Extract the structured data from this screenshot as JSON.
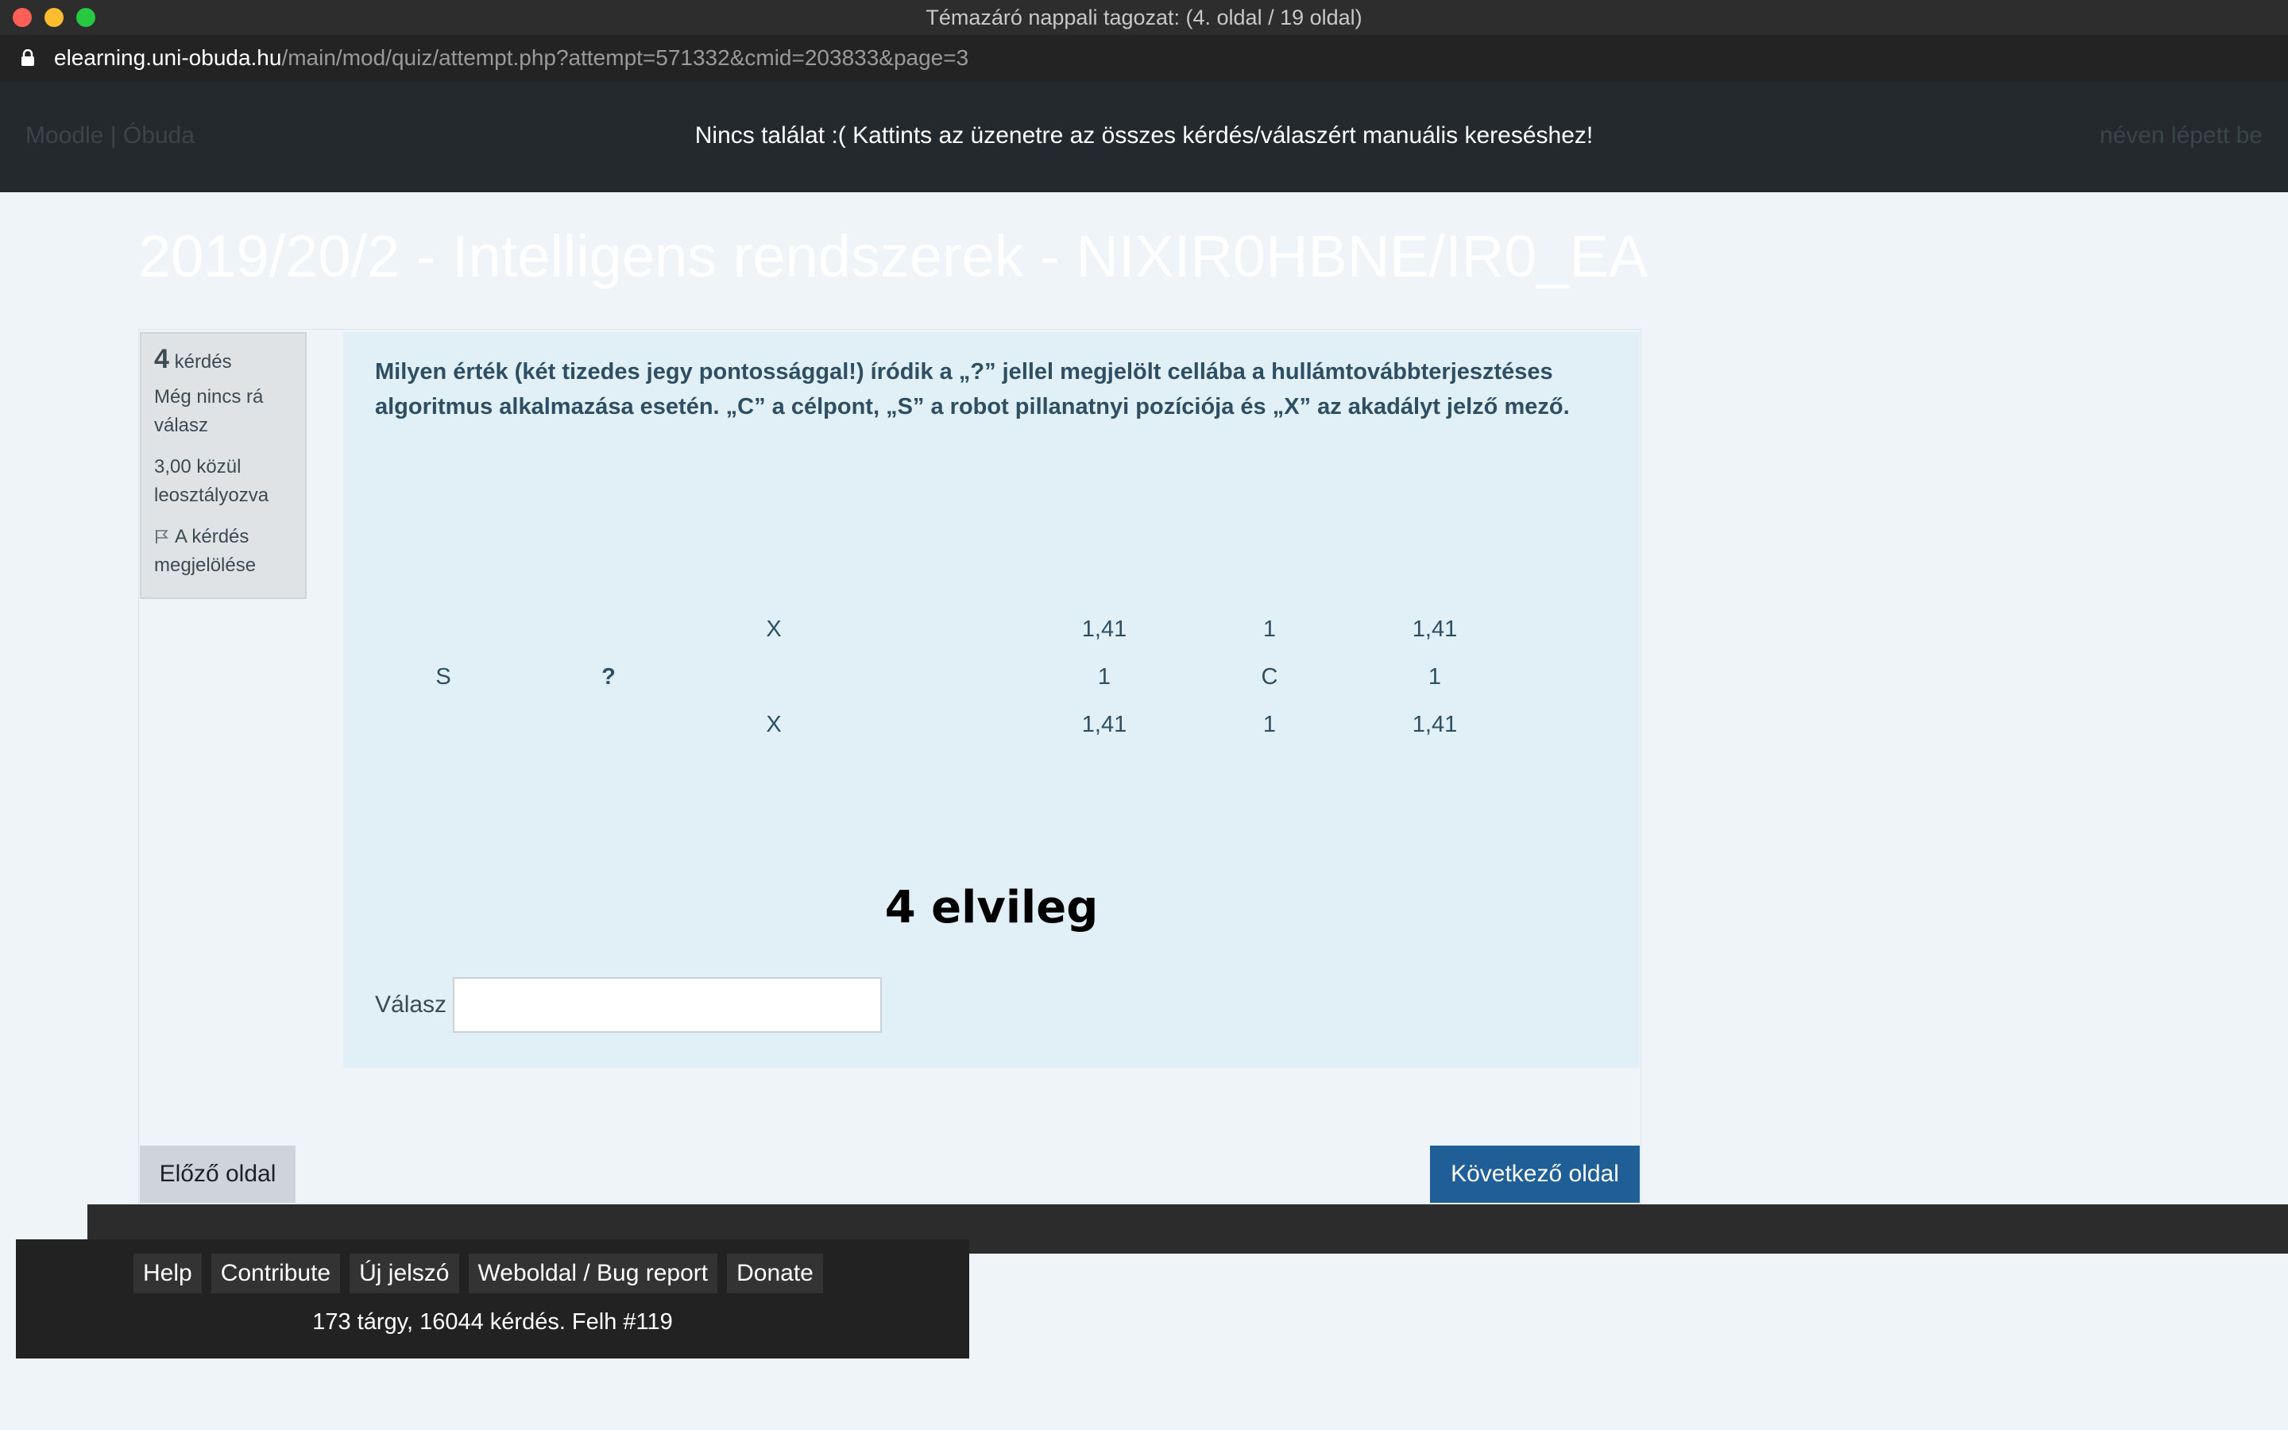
{
  "window": {
    "title": "Témazáró nappali tagozat: (4. oldal / 19 oldal)"
  },
  "urlbar": {
    "host": "elearning.uni-obuda.hu",
    "path": "/main/mod/quiz/attempt.php?attempt=571332&cmid=203833&page=3"
  },
  "header": {
    "brand": "Moodle | Óbuda",
    "notice": "Nincs találat :( Kattints az üzenetre az összes kérdés/válaszért manuális kereséshez!",
    "login": "néven lépett be"
  },
  "course": {
    "title": "2019/20/2 - Intelligens rendszerek - NIXIR0HBNE/IR0_EA"
  },
  "info": {
    "number": "4",
    "number_label": "kérdés",
    "state": "Még nincs rá válasz",
    "grade": "3,00 közül leosztályozva",
    "flag": "A kérdés megjelölése"
  },
  "question": {
    "text": "Milyen érték (két tizedes jegy pontossággal!) íródik a „?” jellel megjelölt cellába a hullámtovábbterjesztéses algoritmus alkalmazása esetén. „C” a célpont, „S” a robot pillanatnyi pozíciója és „X” az akadályt jelző mező.",
    "grid": [
      [
        "",
        "",
        "X",
        "",
        "1,41",
        "1",
        "1,41"
      ],
      [
        "S",
        "?",
        "",
        "",
        "1",
        "C",
        "1"
      ],
      [
        "",
        "",
        "X",
        "",
        "1,41",
        "1",
        "1,41"
      ]
    ],
    "annotation": "4 elvileg",
    "answer_label": "Válasz",
    "answer_value": ""
  },
  "nav": {
    "prev": "Előző oldal",
    "next": "Következő oldal"
  },
  "overlay": {
    "links": [
      "Help",
      "Contribute",
      "Új jelszó",
      "Weboldal / Bug report",
      "Donate"
    ],
    "stats": "173 tárgy, 16044 kérdés. Felh #119"
  }
}
